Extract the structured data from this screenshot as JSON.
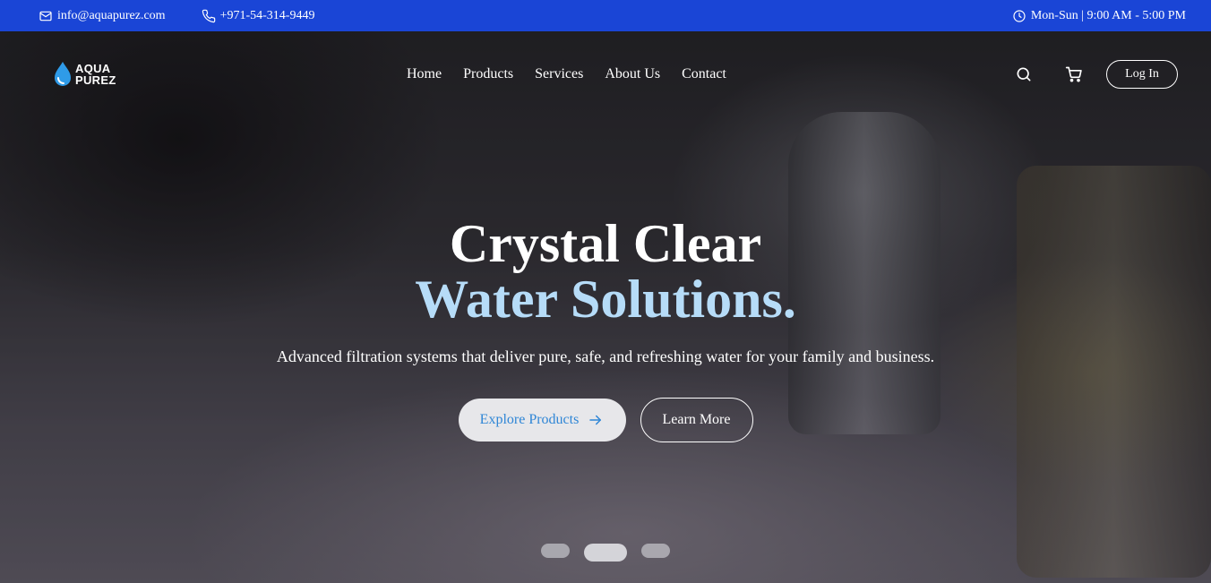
{
  "topbar": {
    "email": "info@aquapurez.com",
    "phone": "+971-54-314-9449",
    "hours": "Mon-Sun | 9:00 AM - 5:00 PM",
    "background": "#1a45d6"
  },
  "logo": {
    "line1": "AQUA",
    "line2": "PUREZ"
  },
  "nav": {
    "links": [
      "Home",
      "Products",
      "Services",
      "About Us",
      "Contact"
    ],
    "login_label": "Log In"
  },
  "hero": {
    "title_line1": "Crystal Clear",
    "title_line2": "Water Solutions.",
    "accent_color": "#b6dcf8",
    "subtitle": "Advanced filtration systems that deliver pure, safe, and refreshing water for your family and business.",
    "primary_cta": "Explore Products",
    "secondary_cta": "Learn More",
    "slides_total": 3,
    "active_slide": 2
  }
}
